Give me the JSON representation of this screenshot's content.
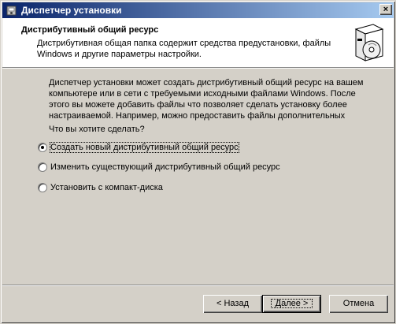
{
  "window": {
    "title": "Диспетчер установки",
    "close_symbol": "×"
  },
  "header": {
    "title": "Дистрибутивный общий ресурс",
    "subtitle": "Дистрибутивная общая папка содержит средства предустановки, файлы Windows и другие параметры настройки."
  },
  "body": {
    "description": "Диспетчер установки может создать дистрибутивный общий ресурс на вашем компьютере или в сети с требуемыми исходными файлами Windows. После этого вы можете добавить файлы что позволяет сделать установку более настраиваемой. Например, можно предоставить файлы дополнительных",
    "question": "Что вы хотите сделать?"
  },
  "options": [
    {
      "label": "Создать новый дистрибутивный общий ресурс",
      "checked": true
    },
    {
      "label": "Изменить существующий дистрибутивный общий ресурс",
      "checked": false
    },
    {
      "label": "Установить с компакт-диска",
      "checked": false
    }
  ],
  "buttons": {
    "back": "< Назад",
    "next": "Далее >",
    "cancel": "Отмена"
  },
  "colors": {
    "title_start": "#0a246a",
    "title_end": "#a6caf0",
    "face": "#d4d0c8"
  },
  "icons": {
    "title": "setup-manager-icon",
    "header": "software-box-cd-icon"
  }
}
